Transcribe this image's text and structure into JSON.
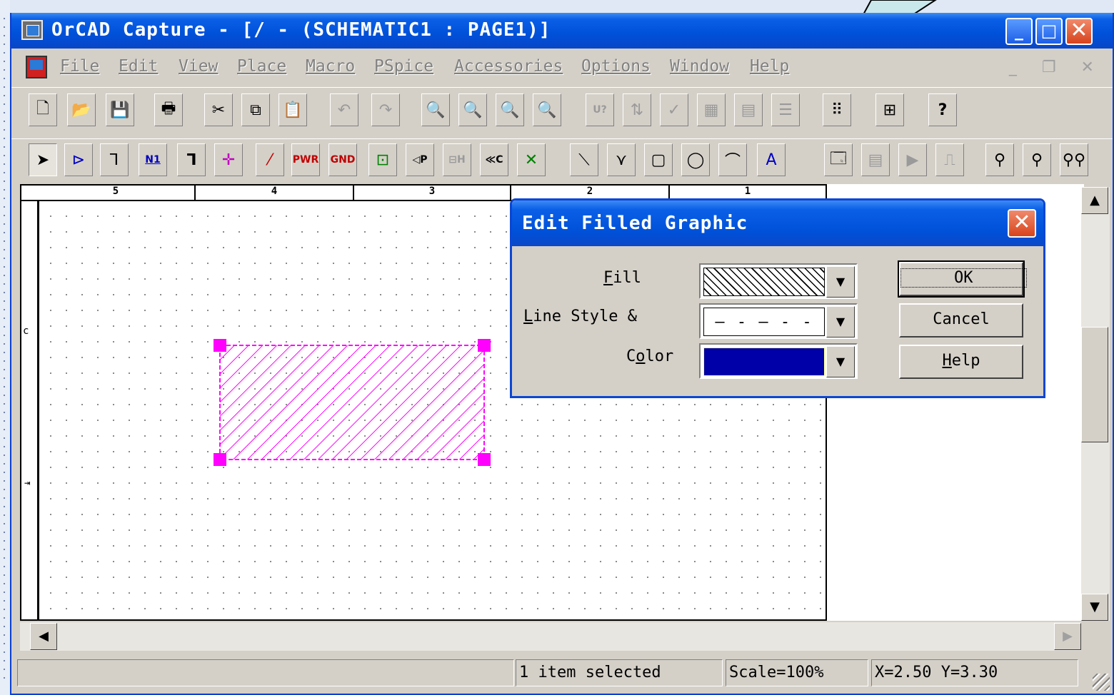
{
  "window": {
    "title": "OrCAD Capture - [/ - (SCHEMATIC1 : PAGE1)]",
    "controls": {
      "minimize": "_",
      "maximize": "□",
      "close": "✕"
    }
  },
  "menu": {
    "items": [
      "File",
      "Edit",
      "View",
      "Place",
      "Macro",
      "PSpice",
      "Accessories",
      "Options",
      "Window",
      "Help"
    ],
    "mdi_controls": "_ ❐ ✕"
  },
  "toolbar1": {
    "icons": [
      "new-icon",
      "open-icon",
      "save-icon",
      "print-icon",
      "cut-icon",
      "copy-icon",
      "paste-icon",
      "undo-icon",
      "redo-icon",
      "zoom-in-icon",
      "zoom-out-icon",
      "zoom-area-icon",
      "zoom-all-icon",
      "annotate-icon",
      "back-annotate-icon",
      "drc-icon",
      "netlist-icon",
      "cross-reference-icon",
      "bill-of-materials-icon",
      "snap-grid-icon",
      "project-manager-icon",
      "help-icon"
    ],
    "help_glyph": "?",
    "annotate_glyph": "U?"
  },
  "toolbar2": {
    "icons": [
      "select-icon",
      "place-part-icon",
      "place-wire-icon",
      "place-net-alias-icon",
      "place-bus-icon",
      "place-junction-icon",
      "place-bus-entry-icon",
      "place-power-icon",
      "place-ground-icon",
      "place-hierarchical-block-icon",
      "place-port-icon",
      "place-pin-icon",
      "place-off-page-connector-icon",
      "place-no-connect-icon",
      "place-line-icon",
      "place-polyline-icon",
      "place-rectangle-icon",
      "place-ellipse-icon",
      "place-arc-icon",
      "place-text-icon",
      "new-simulation-profile-icon",
      "edit-simulation-settings-icon",
      "run-icon",
      "view-simulation-results-icon",
      "voltage-marker-icon",
      "current-marker-icon",
      "differential-marker-icon"
    ],
    "net_alias_label": "N1",
    "power_label": "PWR",
    "ground_label": "GND",
    "off_page_label": "≪C",
    "text_glyph": "A"
  },
  "schematic": {
    "ruler_labels": [
      "5",
      "4",
      "3",
      "2",
      "1"
    ],
    "zone_label": "c",
    "selected_shape": {
      "type": "filled-rectangle",
      "color": "#ff00ff",
      "fill": "diagonal-hatch"
    }
  },
  "dialog": {
    "title": "Edit Filled Graphic",
    "close_label": "✕",
    "fill_label_accel": "F",
    "fill_label_rest": "ill",
    "line_label_accel": "L",
    "line_label_rest": "ine Style &",
    "color_label_start": "C",
    "color_label_accel": "o",
    "color_label_rest": "lor",
    "fill_value": "diagonal-hatch",
    "line_style_value": "— - — - -",
    "color_value": "#0000a8",
    "dropdown_arrow": "▼",
    "ok_label": "OK",
    "cancel_label": "Cancel",
    "help_accel": "H",
    "help_rest": "elp"
  },
  "status": {
    "message": "1 item selected",
    "scale": "Scale=100%",
    "coords": "X=2.50  Y=3.30"
  },
  "colors": {
    "title_bar": "#0050d8",
    "selection": "#ff00ff",
    "callout": "#c8e8ec"
  }
}
